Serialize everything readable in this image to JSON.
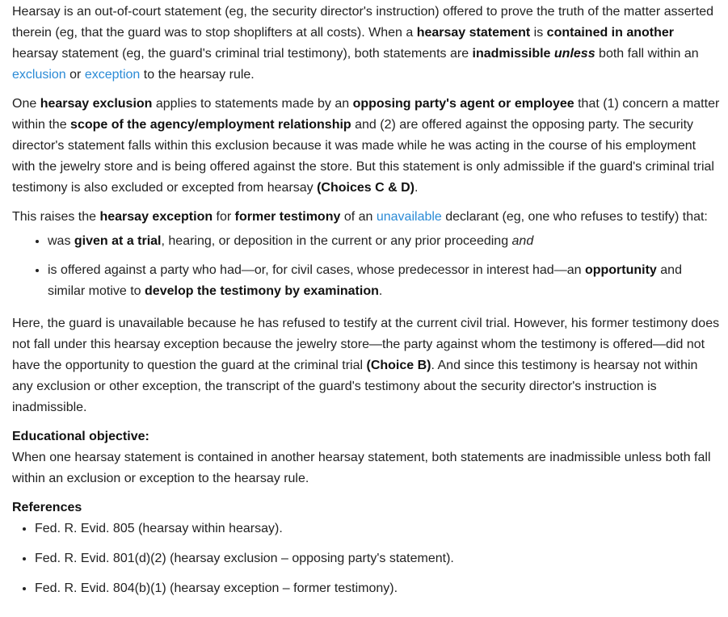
{
  "para1": {
    "t1": "Hearsay is an out-of-court statement (eg, the security director's instruction) offered to prove the truth of the matter asserted therein (eg, that the guard was to stop shoplifters at all costs).  When a ",
    "b1": "hearsay statement",
    "t2": " is ",
    "b2": "contained in another",
    "t3": " hearsay statement (eg, the guard's criminal trial testimony), both statements are ",
    "b3": "inadmissible",
    "t4": " ",
    "bi1": "unless",
    "t5": " both fall within an ",
    "link1": "exclusion",
    "t6": " or ",
    "link2": "exception",
    "t7": " to the hearsay rule."
  },
  "para2": {
    "t1": "One ",
    "b1": "hearsay exclusion",
    "t2": " applies to statements made by an ",
    "b2": "opposing party's agent or employee",
    "t3": " that (1) concern a matter within the ",
    "b3": "scope of the agency/employment relationship",
    "t4": " and (2) are offered against the opposing party.  The security director's statement falls within this exclusion because it was made while he was acting in the course of his employment with the jewelry store and is being offered against the store.  But this statement is only admissible if the guard's criminal trial testimony is also excluded or excepted from hearsay ",
    "b4": "(Choices C & D)",
    "t5": "."
  },
  "para3": {
    "t1": "This raises the ",
    "b1": "hearsay exception",
    "t2": " for ",
    "b2": "former testimony",
    "t3": " of an ",
    "link1": "unavailable",
    "t4": " declarant (eg, one who refuses to testify) that:"
  },
  "bullets": {
    "item1": {
      "t1": "was ",
      "b1": "given at a trial",
      "t2": ", hearing, or deposition in the current or any prior proceeding ",
      "i1": "and"
    },
    "item2": {
      "t1": "is offered against a party who had—or, for civil cases, whose predecessor in interest had—an ",
      "b1": "opportunity",
      "t2": " and similar motive to ",
      "b2": "develop the testimony by examination",
      "t3": "."
    }
  },
  "para4": {
    "t1": "Here, the guard is unavailable because he has refused to testify at the current civil trial.  However, his former testimony does not fall under this hearsay exception because the jewelry store—the party against whom the testimony is offered—did not have the opportunity to question the guard at the criminal trial ",
    "b1": "(Choice B)",
    "t2": ".  And since this testimony is hearsay not within any exclusion or other exception, the transcript of the guard's testimony about the security director's instruction is inadmissible."
  },
  "educational": {
    "heading": "Educational objective:",
    "text": "When one hearsay statement is contained in another hearsay statement, both statements are inadmissible unless both fall within an exclusion or exception to the hearsay rule."
  },
  "references": {
    "heading": "References",
    "items": [
      "Fed. R. Evid. 805 (hearsay within hearsay).",
      "Fed. R. Evid. 801(d)(2) (hearsay exclusion – opposing party's statement).",
      "Fed. R. Evid. 804(b)(1) (hearsay exception – former testimony)."
    ]
  }
}
